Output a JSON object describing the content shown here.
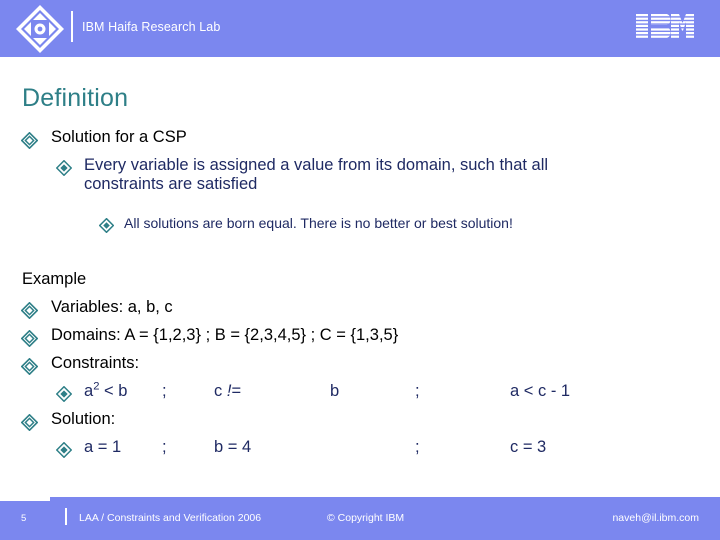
{
  "header": {
    "org_title": "IBM Haifa Research Lab",
    "logo_icon": "haifa-diamond-logo",
    "brand_icon": "ibm-striped-logo",
    "bg_color": "#7b87ef"
  },
  "slide": {
    "title": "Definition",
    "title_color": "#2e7f87",
    "bullet_icon": "diamond-bullet",
    "definition": {
      "level1": "Solution for a CSP",
      "level2_line1": "Every variable is assigned a value from its domain, such that all",
      "level2_line2": "constraints are satisfied",
      "level3": "All solutions are born equal. There is no better or best solution!"
    },
    "example": {
      "heading": "Example",
      "variables": "Variables: a, b, c",
      "domains": "Domains: A = {1,2,3} ; B = {2,3,4,5} ; C = {1,3,5}",
      "constraints_label": "Constraints:",
      "constraint_cells": {
        "c0_base": "a",
        "c0_sup": "2",
        "c0_rest": " < b",
        "c1": ";",
        "c2_pre": "c ",
        "c2_bang": "!",
        "c2_post": "= ",
        "c3": "b",
        "c4": ";",
        "c5": "a < c - 1"
      },
      "solution_label": "Solution:",
      "solution_cells": {
        "c0": "a = 1",
        "c1": ";",
        "c2": "b = 4",
        "c3": "",
        "c4": ";",
        "c5": "c = 3"
      }
    }
  },
  "footer": {
    "page_number": "5",
    "document": "LAA / Constraints and Verification 2006",
    "copyright": "© Copyright IBM",
    "email": "naveh@il.ibm.com",
    "bg_color": "#7b87ef"
  }
}
